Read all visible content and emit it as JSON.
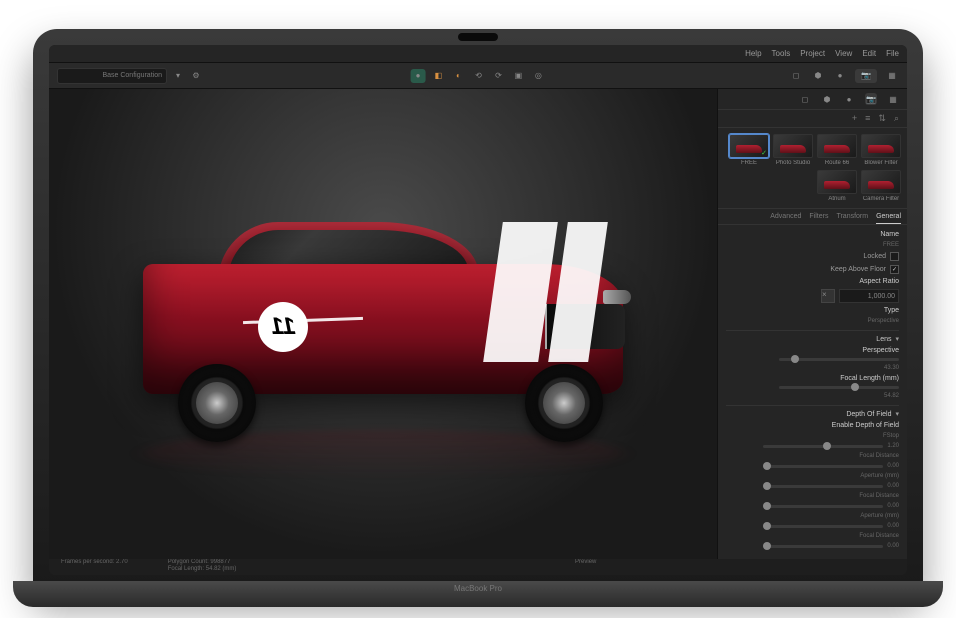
{
  "menubar": {
    "items": [
      "Help",
      "Tools",
      "Project",
      "View",
      "Edit",
      "File"
    ]
  },
  "toolbar": {
    "configurator_label": "Base Configuration"
  },
  "thumbnails": {
    "row1": [
      {
        "label": "FREE",
        "selected": true,
        "check": true
      },
      {
        "label": "Photo Studio"
      },
      {
        "label": "Route 66"
      },
      {
        "label": "Blower Filter"
      }
    ],
    "row2": [
      {
        "label": "Atrium"
      },
      {
        "label": "Camera Filter"
      }
    ]
  },
  "tabs": {
    "items": [
      "Advanced",
      "Filters",
      "Transform",
      "General"
    ],
    "active_index": 3
  },
  "props": {
    "name_label": "Name",
    "name_value": "FREE",
    "locked_label": "Locked",
    "locked": false,
    "keep_above_label": "Keep Above Floor",
    "keep_above": true,
    "aspect_label": "Aspect Ratio",
    "aspect_value": "1,000.00",
    "aspect_btn": "×",
    "type_label": "Type",
    "type_value": "Perspective",
    "lens_label": "Lens",
    "perspective_label": "Perspective",
    "perspective_value": "43.30",
    "focal_label": "Focal Length (mm)",
    "focal_value": "54.82",
    "dof_label": "Depth Of Field",
    "enable_dof_label": "Enable Depth of Field",
    "fstop_label": "FStop",
    "fstop_value": "1.20",
    "focal_dist_label": "Focal Distance",
    "focal_dist_value": "0.00",
    "aperture_label": "Aperture (mm)",
    "aperture_value": "0.00",
    "focal_dist2_label": "Focal Distance",
    "focal_dist2_value": "0.00",
    "aperture2_label": "Aperture (mm)",
    "aperture2_value": "0.00",
    "focal_dist3_label": "Focal Distance",
    "focal_dist3_value": "0.00"
  },
  "car": {
    "number": "11"
  },
  "statusbar": {
    "fps_label": "Frames per second: 2.70",
    "poly_label": "Polygon Count: 998877",
    "focal_info": "Focal Length: 54.82 (mm)",
    "preview_label": "Preview"
  },
  "laptop_label": "MacBook Pro"
}
